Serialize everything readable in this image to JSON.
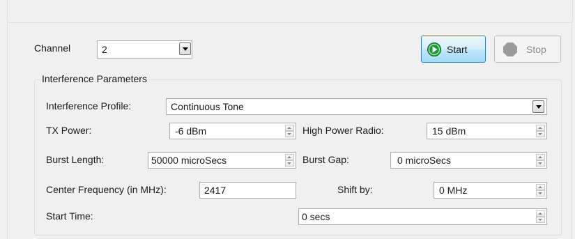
{
  "channel": {
    "label": "Channel",
    "value": "2"
  },
  "buttons": {
    "start": "Start",
    "stop": "Stop"
  },
  "group_title": "Interference Parameters",
  "profile": {
    "label": "Interference Profile:",
    "value": "Continuous Tone"
  },
  "tx_power": {
    "label": "TX Power:",
    "value": "-6 dBm"
  },
  "high_power": {
    "label": "High Power Radio:",
    "value": "15 dBm"
  },
  "burst_length": {
    "label": "Burst Length:",
    "value": "50000 microSecs"
  },
  "burst_gap": {
    "label": "Burst Gap:",
    "value": "0 microSecs"
  },
  "center_freq": {
    "label": "Center Frequency (in MHz):",
    "value": "2417"
  },
  "shift_by": {
    "label": "Shift by:",
    "value": "0 MHz"
  },
  "start_time": {
    "label": "Start Time:",
    "value": "0 secs"
  },
  "icons": {
    "start": "play-icon",
    "stop": "stop-icon"
  },
  "colors": {
    "start_icon": "#1c9a3a",
    "stop_icon": "#9a9a9a",
    "group_border": "#d5dfe5"
  }
}
